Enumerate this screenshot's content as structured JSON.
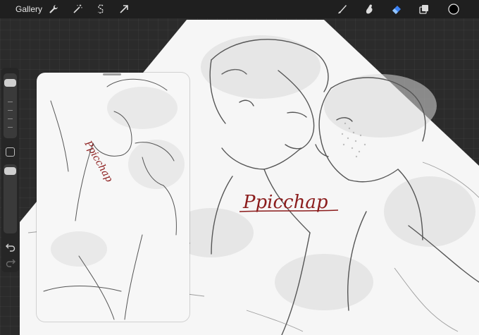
{
  "topbar": {
    "gallery_label": "Gallery",
    "left_tools": [
      "wrench-icon",
      "magic-wand-icon",
      "selection-s-icon",
      "transform-arrow-icon"
    ],
    "right_tools": [
      "brush-icon",
      "smudge-icon",
      "eraser-icon",
      "layers-icon",
      "color-swatch"
    ],
    "active_tool": "eraser",
    "accent_color": "#3b82f6",
    "current_color": "#000000"
  },
  "canvas": {
    "watermark_text": "Ppicchap",
    "watermark_color": "#8b1c1c"
  },
  "reference": {
    "watermark_text": "Ppicchap"
  },
  "sidebar": {
    "brush_size_level": 0.9,
    "opacity_level": 0.95
  }
}
